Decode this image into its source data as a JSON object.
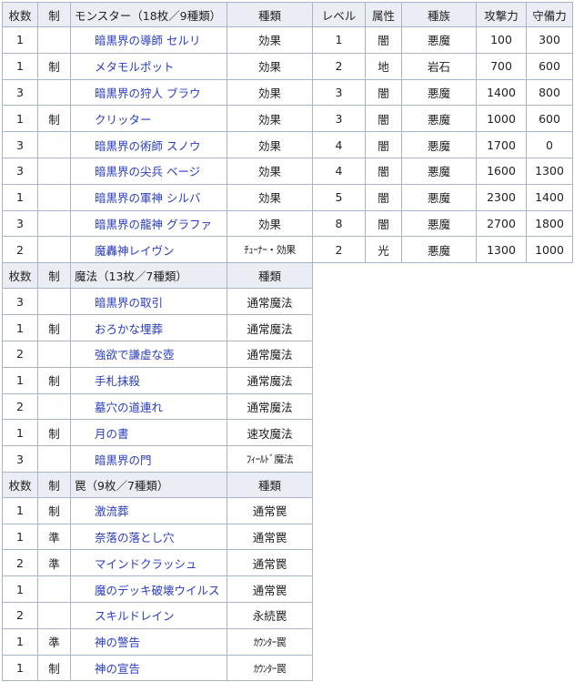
{
  "monster": {
    "headers": {
      "count": "枚数",
      "limit": "制",
      "name": "モンスター（18枚／9種類）",
      "kind": "種類",
      "level": "レベル",
      "attr": "属性",
      "race": "種族",
      "atk": "攻撃力",
      "def": "守備力"
    },
    "rows": [
      {
        "count": "1",
        "limit": "",
        "name": "暗黒界の導師 セルリ",
        "kind": "効果",
        "level": "1",
        "attr": "闇",
        "race": "悪魔",
        "atk": "100",
        "def": "300"
      },
      {
        "count": "1",
        "limit": "制",
        "name": "メタモルポット",
        "kind": "効果",
        "level": "2",
        "attr": "地",
        "race": "岩石",
        "atk": "700",
        "def": "600"
      },
      {
        "count": "3",
        "limit": "",
        "name": "暗黒界の狩人 ブラウ",
        "kind": "効果",
        "level": "3",
        "attr": "闇",
        "race": "悪魔",
        "atk": "1400",
        "def": "800"
      },
      {
        "count": "1",
        "limit": "制",
        "name": "クリッター",
        "kind": "効果",
        "level": "3",
        "attr": "闇",
        "race": "悪魔",
        "atk": "1000",
        "def": "600"
      },
      {
        "count": "3",
        "limit": "",
        "name": "暗黒界の術師 スノウ",
        "kind": "効果",
        "level": "4",
        "attr": "闇",
        "race": "悪魔",
        "atk": "1700",
        "def": "0"
      },
      {
        "count": "3",
        "limit": "",
        "name": "暗黒界の尖兵 ベージ",
        "kind": "効果",
        "level": "4",
        "attr": "闇",
        "race": "悪魔",
        "atk": "1600",
        "def": "1300"
      },
      {
        "count": "1",
        "limit": "",
        "name": "暗黒界の軍神 シルバ",
        "kind": "効果",
        "level": "5",
        "attr": "闇",
        "race": "悪魔",
        "atk": "2300",
        "def": "1400"
      },
      {
        "count": "3",
        "limit": "",
        "name": "暗黒界の龍神 グラファ",
        "kind": "効果",
        "level": "8",
        "attr": "闇",
        "race": "悪魔",
        "atk": "2700",
        "def": "1800"
      },
      {
        "count": "2",
        "limit": "",
        "name": "魔轟神レイヴン",
        "kind": "ﾁｭｰﾅｰ・効果",
        "level": "2",
        "attr": "光",
        "race": "悪魔",
        "atk": "1300",
        "def": "1000"
      }
    ]
  },
  "spell": {
    "headers": {
      "count": "枚数",
      "limit": "制",
      "name": "魔法（13枚／7種類）",
      "kind": "種類"
    },
    "rows": [
      {
        "count": "3",
        "limit": "",
        "name": "暗黒界の取引",
        "kind": "通常魔法"
      },
      {
        "count": "1",
        "limit": "制",
        "name": "おろかな埋葬",
        "kind": "通常魔法"
      },
      {
        "count": "2",
        "limit": "",
        "name": "強欲で謙虚な壺",
        "kind": "通常魔法"
      },
      {
        "count": "1",
        "limit": "制",
        "name": "手札抹殺",
        "kind": "通常魔法"
      },
      {
        "count": "2",
        "limit": "",
        "name": "墓穴の道連れ",
        "kind": "通常魔法"
      },
      {
        "count": "1",
        "limit": "制",
        "name": "月の書",
        "kind": "速攻魔法"
      },
      {
        "count": "3",
        "limit": "",
        "name": "暗黒界の門",
        "kind": "ﾌｨｰﾙﾄﾞ魔法"
      }
    ]
  },
  "trap": {
    "headers": {
      "count": "枚数",
      "limit": "制",
      "name": "罠（9枚／7種類）",
      "kind": "種類"
    },
    "rows": [
      {
        "count": "1",
        "limit": "制",
        "name": "激流葬",
        "kind": "通常罠"
      },
      {
        "count": "1",
        "limit": "準",
        "name": "奈落の落とし穴",
        "kind": "通常罠"
      },
      {
        "count": "2",
        "limit": "準",
        "name": "マインドクラッシュ",
        "kind": "通常罠"
      },
      {
        "count": "1",
        "limit": "",
        "name": "魔のデッキ破壊ウイルス",
        "kind": "通常罠"
      },
      {
        "count": "2",
        "limit": "",
        "name": "スキルドレイン",
        "kind": "永続罠"
      },
      {
        "count": "1",
        "limit": "準",
        "name": "神の警告",
        "kind": "ｶｳﾝﾀｰ罠"
      },
      {
        "count": "1",
        "limit": "制",
        "name": "神の宣告",
        "kind": "ｶｳﾝﾀｰ罠"
      }
    ]
  }
}
